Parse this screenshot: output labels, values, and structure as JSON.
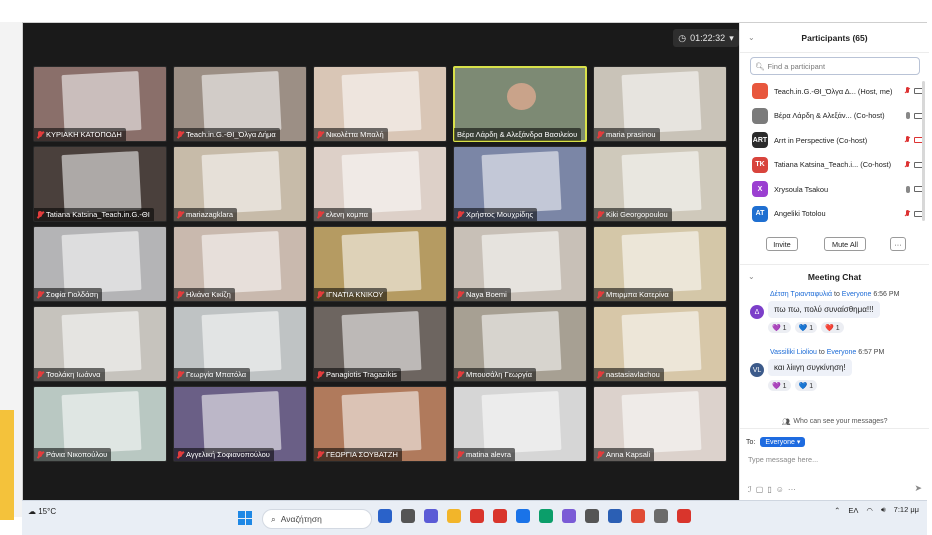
{
  "meeting": {
    "timer": "01:22:32",
    "tiles": [
      {
        "name": "ΚΥΡΙΑΚΗ ΚΑΤΟΠΟΔΗ",
        "bg": "#8a6f6a",
        "muted": true
      },
      {
        "name": "Teach.in.G.-ΘΙ_Όλγα Δήμα",
        "bg": "#9c8f85",
        "muted": true
      },
      {
        "name": "Νικολέττα Μπαλή",
        "bg": "#d9c6b6",
        "muted": true
      },
      {
        "name": "Βέρα Λάρδη & Αλεξάνδρα Βασιλείου",
        "bg": "#7d8a74",
        "muted": false,
        "active": true
      },
      {
        "name": "maria prasinou",
        "bg": "#c9c3b8",
        "muted": true
      },
      {
        "name": "Tatiana Katsina_Teach.in.G.-ΘΙ",
        "bg": "#4a403c",
        "muted": true
      },
      {
        "name": "mariazagklara",
        "bg": "#c7bba9",
        "muted": true
      },
      {
        "name": "ελενη κομπα",
        "bg": "#ddd0c8",
        "muted": true
      },
      {
        "name": "Χρήστος Μουχρίδης",
        "bg": "#7b86a6",
        "muted": true
      },
      {
        "name": "Kiki Georgopoulou",
        "bg": "#cfc9bb",
        "muted": true
      },
      {
        "name": "Σοφία Γιολδάση",
        "bg": "#b4b4b6",
        "muted": true
      },
      {
        "name": "Ηλιάνα Κικίζη",
        "bg": "#c9b9ae",
        "muted": true
      },
      {
        "name": "ΙΓΝΑΤΙΑ ΚΝΙΚΟΥ",
        "bg": "#b59b62",
        "muted": true
      },
      {
        "name": "Naya Boemi",
        "bg": "#c8c0b7",
        "muted": true
      },
      {
        "name": "Μπιρμπα Κατερίνα",
        "bg": "#d4c7a8",
        "muted": true
      },
      {
        "name": "Τσολάκη Ιωάννα",
        "bg": "#c6c3bd",
        "muted": true
      },
      {
        "name": "Γεωργία Μπατόλα",
        "bg": "#bfc3c4",
        "muted": true
      },
      {
        "name": "Panagiotis Tragazikis",
        "bg": "#6d6560",
        "muted": true
      },
      {
        "name": "Μπουσάλη Γεωργία",
        "bg": "#a7a093",
        "muted": true
      },
      {
        "name": "nastasiavlachou",
        "bg": "#d7c7a8",
        "muted": true
      },
      {
        "name": "Ράνια Νικοπούλου",
        "bg": "#b9c8c2",
        "muted": true
      },
      {
        "name": "Αγγελική Σοφιανοπούλου",
        "bg": "#6a5f86",
        "muted": true
      },
      {
        "name": "ΓΕΩΡΓΙΑ ΣΟΥΒΑΤΖΗ",
        "bg": "#b07a5c",
        "muted": true
      },
      {
        "name": "matina alevra",
        "bg": "#d6d6d6",
        "muted": true
      },
      {
        "name": "Anna Kapsali",
        "bg": "#dcd2cc",
        "muted": true
      }
    ]
  },
  "participants": {
    "title": "Participants (65)",
    "search_placeholder": "Find a participant",
    "list": [
      {
        "name": "Teach.in.G.-ΘΙ_Όλγα Δ... (Host, me)",
        "avatar_text": "",
        "avatar_color": "#e8573d"
      },
      {
        "name": "Βέρα Λάρδη & Αλεξάν... (Co-host)",
        "avatar_text": "",
        "avatar_color": "#7b7b7b"
      },
      {
        "name": "Arrt in Perspective (Co-host)",
        "avatar_text": "ART",
        "avatar_color": "#2b2b2b"
      },
      {
        "name": "Tatiana Katsina_Teach.i... (Co-host)",
        "avatar_text": "TK",
        "avatar_color": "#d8443c"
      },
      {
        "name": "Xrysoula Tsakou",
        "avatar_text": "X",
        "avatar_color": "#9b3fd1"
      },
      {
        "name": "Angeliki Totolou",
        "avatar_text": "AT",
        "avatar_color": "#1f6fd1"
      }
    ],
    "invite_label": "Invite",
    "mute_all_label": "Mute All",
    "more_label": "···"
  },
  "chat": {
    "title": "Meeting Chat",
    "messages": [
      {
        "from": "Δέτση Τριανταφυλιά",
        "to_word": "to",
        "to": "Everyone",
        "time": "6:56 PM",
        "text": "πω πω, πολύ συναίσθημα!!!",
        "avatar": "Δ",
        "avatar_color": "#7c3fc9",
        "reactions": [
          "💜 1",
          "💙 1",
          "❤️ 1"
        ]
      },
      {
        "from": "Vassiliki Lioliou",
        "to_word": "to",
        "to": "Everyone",
        "time": "6:57 PM",
        "text": "και λίιιγη συγκίνηση!",
        "avatar": "VL",
        "avatar_color": "#3c5a8a",
        "reactions": [
          "💜 1",
          "💙 1"
        ]
      }
    ],
    "who_can_see": "Who can see your messages?",
    "to_label": "To:",
    "to_value": "Everyone",
    "placeholder": "Type message here..."
  },
  "taskbar": {
    "weather": "15°C",
    "search_placeholder": "Αναζήτηση",
    "lang": "ΕΛ",
    "time": "7:12 μμ"
  },
  "colors": {
    "accent": "#1e6be0",
    "muted_red": "#e23c3c",
    "active_speaker": "#d9e14a"
  }
}
